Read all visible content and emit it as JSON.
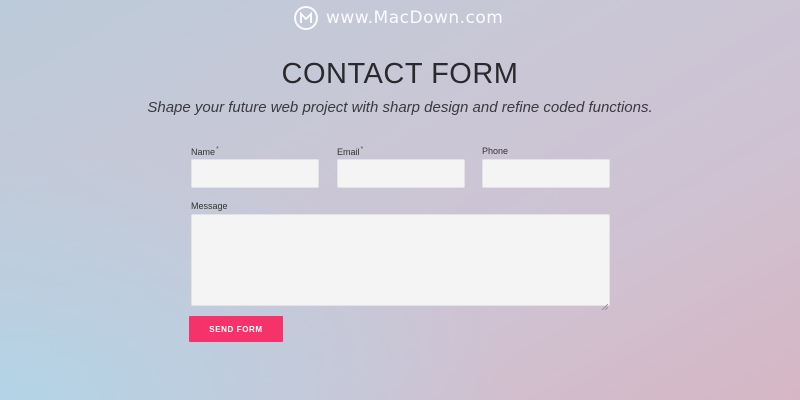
{
  "watermark": {
    "text": "www.MacDown.com",
    "logo_letter": "M"
  },
  "header": {
    "title": "CONTACT FORM",
    "subtitle": "Shape your future web project with sharp design and refine coded functions."
  },
  "form": {
    "name": {
      "label": "Name",
      "required_mark": "*",
      "value": ""
    },
    "email": {
      "label": "Email",
      "required_mark": "*",
      "value": ""
    },
    "phone": {
      "label": "Phone",
      "value": ""
    },
    "message": {
      "label": "Message",
      "value": ""
    },
    "submit_label": "SEND FORM"
  },
  "colors": {
    "accent": "#f5336a",
    "input_bg": "#f4f4f5",
    "title_text": "#2a2a2e"
  }
}
